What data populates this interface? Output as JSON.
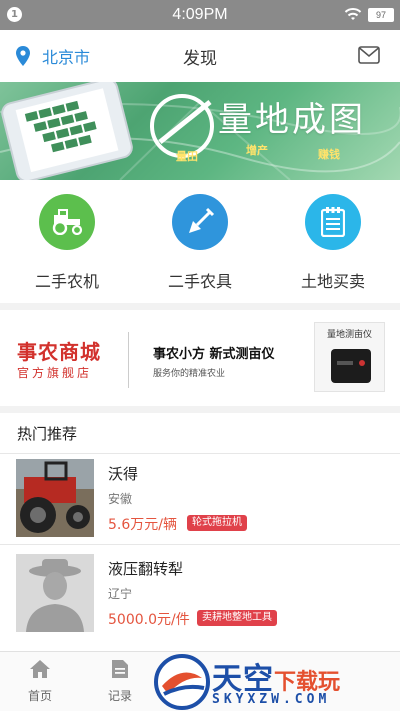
{
  "status_bar": {
    "notification_count": "1",
    "time": "4:09PM",
    "battery": "97"
  },
  "header": {
    "location": "北京市",
    "title": "发现"
  },
  "banner": {
    "title": "量地成图",
    "tags": [
      "量田",
      "增产",
      "赚钱"
    ]
  },
  "categories": [
    {
      "label": "二手农机",
      "icon": "tractor-icon",
      "color": "#5cbf4d"
    },
    {
      "label": "二手农具",
      "icon": "shovel-icon",
      "color": "#2f95dc"
    },
    {
      "label": "土地买卖",
      "icon": "document-icon",
      "color": "#2bb6e9"
    }
  ],
  "promo": {
    "shop_name": "事农商城",
    "shop_subtitle": "官方旗舰店",
    "headline": "事农小方   新式测亩仪",
    "subline": "服务你的精准农业",
    "device_label": "量地测亩仪"
  },
  "hot": {
    "title": "热门推荐",
    "items": [
      {
        "name": "沃得",
        "region": "安徽",
        "price": "5.6万元/辆",
        "tag": "轮式拖拉机"
      },
      {
        "name": "液压翻转犁",
        "region": "辽宁",
        "price": "5000.0元/件",
        "tag": "卖耕地整地工具"
      }
    ]
  },
  "bottom_nav": [
    {
      "label": "首页",
      "icon": "home-icon"
    },
    {
      "label": "记录",
      "icon": "record-icon"
    }
  ],
  "watermark": {
    "title": "天空",
    "title_suffix": "下载玩",
    "url": "SKYXZW.COM"
  },
  "colors": {
    "accent_blue": "#2a8ad8",
    "brand_red": "#d2322d",
    "price_red": "#e4553f",
    "tag_red": "#e0414a"
  }
}
